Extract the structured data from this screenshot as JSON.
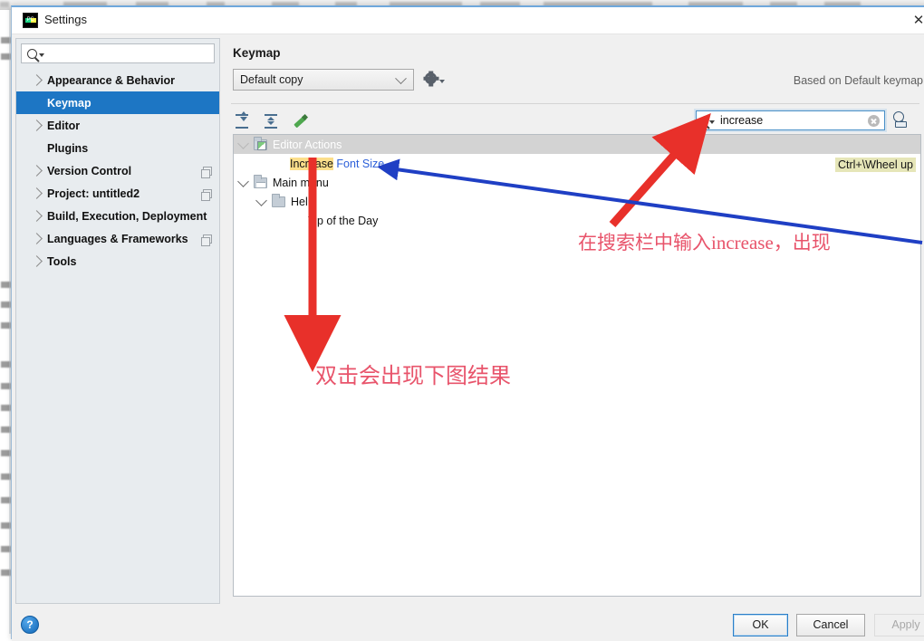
{
  "window": {
    "title": "Settings",
    "logo_icon": "pycharm-logo-icon",
    "close_icon": "close-icon"
  },
  "sidebar": {
    "search": {
      "value": "",
      "placeholder": "",
      "icon": "search-icon",
      "dropdown_icon": "chevron-down-icon"
    },
    "items": [
      {
        "label": "Appearance & Behavior",
        "chevron": true,
        "selected": false,
        "badge": false
      },
      {
        "label": "Keymap",
        "chevron": false,
        "selected": true,
        "badge": false
      },
      {
        "label": "Editor",
        "chevron": true,
        "selected": false,
        "badge": false
      },
      {
        "label": "Plugins",
        "chevron": false,
        "selected": false,
        "badge": false
      },
      {
        "label": "Version Control",
        "chevron": true,
        "selected": false,
        "badge": true
      },
      {
        "label": "Project: untitled2",
        "chevron": true,
        "selected": false,
        "badge": true
      },
      {
        "label": "Build, Execution, Deployment",
        "chevron": true,
        "selected": false,
        "badge": false
      },
      {
        "label": "Languages & Frameworks",
        "chevron": true,
        "selected": false,
        "badge": true
      },
      {
        "label": "Tools",
        "chevron": true,
        "selected": false,
        "badge": false
      }
    ]
  },
  "main": {
    "title": "Keymap",
    "keymap_select": {
      "value": "Default copy",
      "icon": "chevron-down-icon"
    },
    "gear_icon": "gear-icon",
    "based_on": "Based on Default keymap",
    "toolbar": [
      {
        "name": "expand-all-icon",
        "tooltip": "Expand All"
      },
      {
        "name": "collapse-all-icon",
        "tooltip": "Collapse All"
      },
      {
        "name": "edit-shortcut-icon",
        "tooltip": "Edit Shortcut"
      }
    ],
    "find": {
      "value": "increase",
      "search_icon": "search-icon",
      "dropdown_icon": "chevron-down-icon",
      "clear_icon": "clear-circle-icon"
    },
    "find_by_shortcut_icon": "find-by-shortcut-icon",
    "tree": [
      {
        "label": "Editor Actions",
        "indent": 0,
        "twisty": "down",
        "icon": "actions-folder-icon",
        "state": "selected"
      },
      {
        "label_parts": {
          "highlight": "Increase",
          "rest": " Font Size"
        },
        "indent": 2,
        "twisty": "none",
        "icon": "none",
        "state": "normal"
      },
      {
        "label": "Main menu",
        "indent": 0,
        "twisty": "down",
        "icon": "menu-folder-icon",
        "state": "normal"
      },
      {
        "label": "Help",
        "indent": 1,
        "twisty": "down",
        "icon": "folder-icon",
        "state": "normal"
      },
      {
        "label": "Tip of the Day",
        "indent": 3,
        "twisty": "none",
        "icon": "none",
        "state": "normal"
      }
    ],
    "shortcut_badge": "Ctrl+\\Wheel up"
  },
  "footer": {
    "help_icon": "help-icon",
    "help_label": "?",
    "ok": "OK",
    "cancel": "Cancel",
    "apply": "Apply"
  },
  "annotations": [
    {
      "text": "在搜索栏中输入increase，出现",
      "color": "#e8546b"
    },
    {
      "text": "双击会出现下图结果",
      "color": "#e8546b"
    }
  ],
  "colors": {
    "selection_blue": "#1d76c4",
    "highlight_yellow": "#fcdf8b",
    "badge_yellow": "#e6e6b8",
    "link_blue": "#2b5fd9",
    "annotation_red": "#e8546b",
    "arrow_red": "#e8302a",
    "arrow_blue": "#1f3fc4"
  }
}
